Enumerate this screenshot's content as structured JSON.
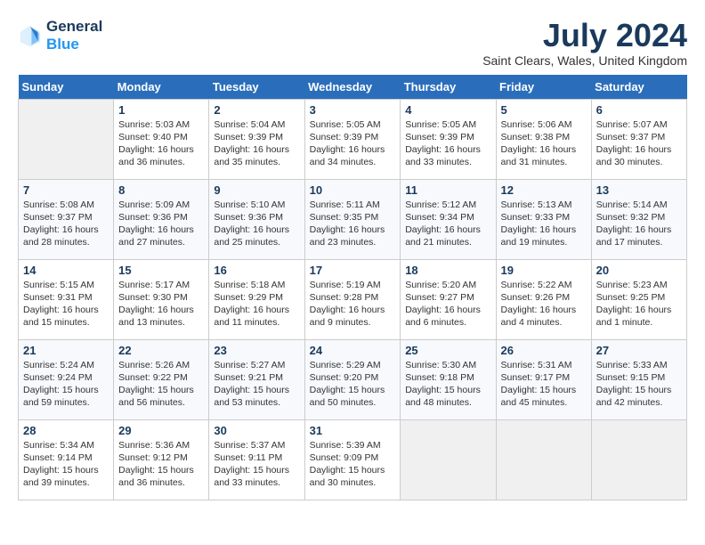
{
  "header": {
    "logo_line1": "General",
    "logo_line2": "Blue",
    "month_year": "July 2024",
    "location": "Saint Clears, Wales, United Kingdom"
  },
  "days_of_week": [
    "Sunday",
    "Monday",
    "Tuesday",
    "Wednesday",
    "Thursday",
    "Friday",
    "Saturday"
  ],
  "weeks": [
    [
      {
        "day": "",
        "info": ""
      },
      {
        "day": "1",
        "info": "Sunrise: 5:03 AM\nSunset: 9:40 PM\nDaylight: 16 hours\nand 36 minutes."
      },
      {
        "day": "2",
        "info": "Sunrise: 5:04 AM\nSunset: 9:39 PM\nDaylight: 16 hours\nand 35 minutes."
      },
      {
        "day": "3",
        "info": "Sunrise: 5:05 AM\nSunset: 9:39 PM\nDaylight: 16 hours\nand 34 minutes."
      },
      {
        "day": "4",
        "info": "Sunrise: 5:05 AM\nSunset: 9:39 PM\nDaylight: 16 hours\nand 33 minutes."
      },
      {
        "day": "5",
        "info": "Sunrise: 5:06 AM\nSunset: 9:38 PM\nDaylight: 16 hours\nand 31 minutes."
      },
      {
        "day": "6",
        "info": "Sunrise: 5:07 AM\nSunset: 9:37 PM\nDaylight: 16 hours\nand 30 minutes."
      }
    ],
    [
      {
        "day": "7",
        "info": "Sunrise: 5:08 AM\nSunset: 9:37 PM\nDaylight: 16 hours\nand 28 minutes."
      },
      {
        "day": "8",
        "info": "Sunrise: 5:09 AM\nSunset: 9:36 PM\nDaylight: 16 hours\nand 27 minutes."
      },
      {
        "day": "9",
        "info": "Sunrise: 5:10 AM\nSunset: 9:36 PM\nDaylight: 16 hours\nand 25 minutes."
      },
      {
        "day": "10",
        "info": "Sunrise: 5:11 AM\nSunset: 9:35 PM\nDaylight: 16 hours\nand 23 minutes."
      },
      {
        "day": "11",
        "info": "Sunrise: 5:12 AM\nSunset: 9:34 PM\nDaylight: 16 hours\nand 21 minutes."
      },
      {
        "day": "12",
        "info": "Sunrise: 5:13 AM\nSunset: 9:33 PM\nDaylight: 16 hours\nand 19 minutes."
      },
      {
        "day": "13",
        "info": "Sunrise: 5:14 AM\nSunset: 9:32 PM\nDaylight: 16 hours\nand 17 minutes."
      }
    ],
    [
      {
        "day": "14",
        "info": "Sunrise: 5:15 AM\nSunset: 9:31 PM\nDaylight: 16 hours\nand 15 minutes."
      },
      {
        "day": "15",
        "info": "Sunrise: 5:17 AM\nSunset: 9:30 PM\nDaylight: 16 hours\nand 13 minutes."
      },
      {
        "day": "16",
        "info": "Sunrise: 5:18 AM\nSunset: 9:29 PM\nDaylight: 16 hours\nand 11 minutes."
      },
      {
        "day": "17",
        "info": "Sunrise: 5:19 AM\nSunset: 9:28 PM\nDaylight: 16 hours\nand 9 minutes."
      },
      {
        "day": "18",
        "info": "Sunrise: 5:20 AM\nSunset: 9:27 PM\nDaylight: 16 hours\nand 6 minutes."
      },
      {
        "day": "19",
        "info": "Sunrise: 5:22 AM\nSunset: 9:26 PM\nDaylight: 16 hours\nand 4 minutes."
      },
      {
        "day": "20",
        "info": "Sunrise: 5:23 AM\nSunset: 9:25 PM\nDaylight: 16 hours\nand 1 minute."
      }
    ],
    [
      {
        "day": "21",
        "info": "Sunrise: 5:24 AM\nSunset: 9:24 PM\nDaylight: 15 hours\nand 59 minutes."
      },
      {
        "day": "22",
        "info": "Sunrise: 5:26 AM\nSunset: 9:22 PM\nDaylight: 15 hours\nand 56 minutes."
      },
      {
        "day": "23",
        "info": "Sunrise: 5:27 AM\nSunset: 9:21 PM\nDaylight: 15 hours\nand 53 minutes."
      },
      {
        "day": "24",
        "info": "Sunrise: 5:29 AM\nSunset: 9:20 PM\nDaylight: 15 hours\nand 50 minutes."
      },
      {
        "day": "25",
        "info": "Sunrise: 5:30 AM\nSunset: 9:18 PM\nDaylight: 15 hours\nand 48 minutes."
      },
      {
        "day": "26",
        "info": "Sunrise: 5:31 AM\nSunset: 9:17 PM\nDaylight: 15 hours\nand 45 minutes."
      },
      {
        "day": "27",
        "info": "Sunrise: 5:33 AM\nSunset: 9:15 PM\nDaylight: 15 hours\nand 42 minutes."
      }
    ],
    [
      {
        "day": "28",
        "info": "Sunrise: 5:34 AM\nSunset: 9:14 PM\nDaylight: 15 hours\nand 39 minutes."
      },
      {
        "day": "29",
        "info": "Sunrise: 5:36 AM\nSunset: 9:12 PM\nDaylight: 15 hours\nand 36 minutes."
      },
      {
        "day": "30",
        "info": "Sunrise: 5:37 AM\nSunset: 9:11 PM\nDaylight: 15 hours\nand 33 minutes."
      },
      {
        "day": "31",
        "info": "Sunrise: 5:39 AM\nSunset: 9:09 PM\nDaylight: 15 hours\nand 30 minutes."
      },
      {
        "day": "",
        "info": ""
      },
      {
        "day": "",
        "info": ""
      },
      {
        "day": "",
        "info": ""
      }
    ]
  ]
}
